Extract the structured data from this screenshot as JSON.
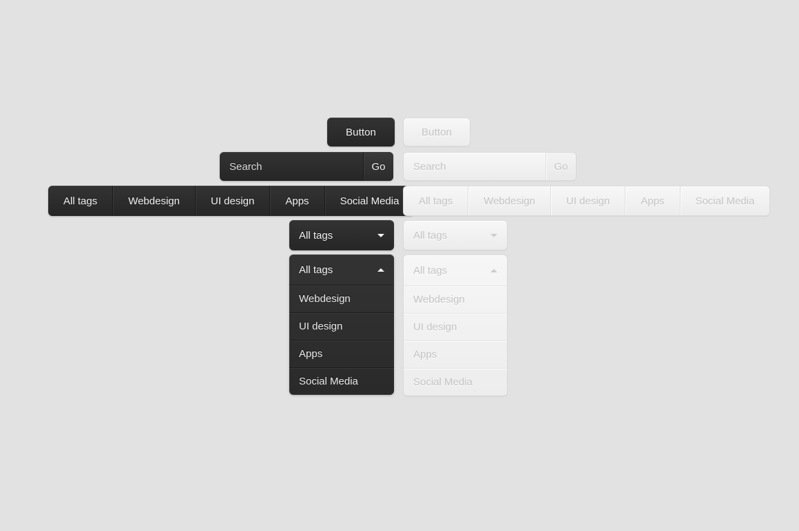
{
  "theme": {
    "page_background": "#e2e2e2",
    "dark_surface": "#2b2b2b",
    "dark_text": "#f2f2f2",
    "light_surface": "#f1f1f1",
    "light_text": "#c4c4c4",
    "light_border": "#dadada"
  },
  "buttons": {
    "dark": {
      "label": "Button"
    },
    "light": {
      "label": "Button"
    }
  },
  "search": {
    "dark": {
      "placeholder": "Search",
      "value": "Search",
      "go_label": "Go"
    },
    "light": {
      "placeholder": "Search",
      "value": "Search",
      "go_label": "Go"
    }
  },
  "tabbar": {
    "dark": {
      "tabs": [
        {
          "label": "All tags"
        },
        {
          "label": "Webdesign"
        },
        {
          "label": "UI design"
        },
        {
          "label": "Apps"
        },
        {
          "label": "Social Media"
        }
      ]
    },
    "light": {
      "tabs": [
        {
          "label": "All tags"
        },
        {
          "label": "Webdesign"
        },
        {
          "label": "UI design"
        },
        {
          "label": "Apps"
        },
        {
          "label": "Social Media"
        }
      ]
    }
  },
  "dropdown_closed": {
    "dark": {
      "selected": "All tags",
      "caret_icon": "chevron-down-icon"
    },
    "light": {
      "selected": "All tags",
      "caret_icon": "chevron-down-icon"
    }
  },
  "dropdown_open": {
    "dark": {
      "selected": "All tags",
      "caret_icon": "chevron-up-icon",
      "items": [
        {
          "label": "Webdesign"
        },
        {
          "label": "UI design"
        },
        {
          "label": "Apps"
        },
        {
          "label": "Social Media"
        }
      ]
    },
    "light": {
      "selected": "All tags",
      "caret_icon": "chevron-up-icon",
      "items": [
        {
          "label": "Webdesign"
        },
        {
          "label": "UI design"
        },
        {
          "label": "Apps"
        },
        {
          "label": "Social Media"
        }
      ]
    }
  }
}
